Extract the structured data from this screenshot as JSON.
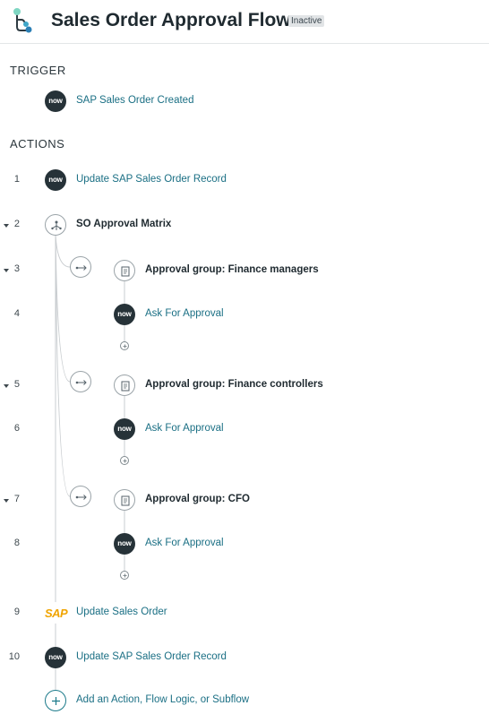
{
  "header": {
    "title": "Sales Order Approval Flow",
    "status": "Inactive"
  },
  "trigger": {
    "section_label": "TRIGGER",
    "icon": "now-icon",
    "icon_text": "now",
    "label": "SAP Sales Order Created"
  },
  "actions": {
    "section_label": "ACTIONS",
    "items": [
      {
        "number": "1",
        "icon": "now-icon",
        "icon_text": "now",
        "label": "Update SAP Sales Order Record"
      },
      {
        "number": "2",
        "icon": "branch-icon",
        "label": "SO Approval Matrix",
        "collapsible": true
      },
      {
        "number": "3",
        "icon": "group-icon",
        "label": "Approval group: Finance managers",
        "collapsible": true
      },
      {
        "number": "4",
        "icon": "now-icon",
        "icon_text": "now",
        "label": "Ask For Approval"
      },
      {
        "number": "5",
        "icon": "group-icon",
        "label": "Approval group: Finance controllers",
        "collapsible": true
      },
      {
        "number": "6",
        "icon": "now-icon",
        "icon_text": "now",
        "label": "Ask For Approval"
      },
      {
        "number": "7",
        "icon": "group-icon",
        "label": "Approval group: CFO",
        "collapsible": true
      },
      {
        "number": "8",
        "icon": "now-icon",
        "icon_text": "now",
        "label": "Ask For Approval"
      },
      {
        "number": "9",
        "icon": "sap-icon",
        "icon_text": "SAP",
        "label": "Update Sales Order"
      },
      {
        "number": "10",
        "icon": "now-icon",
        "icon_text": "now",
        "label": "Update SAP Sales Order Record"
      }
    ],
    "add_label": "Add an Action, Flow Logic, or Subflow"
  },
  "colors": {
    "link": "#1a6f84",
    "now_icon_bg": "#263238",
    "sap_logo": "#f0a400",
    "badge_bg": "#e1e4e6"
  }
}
